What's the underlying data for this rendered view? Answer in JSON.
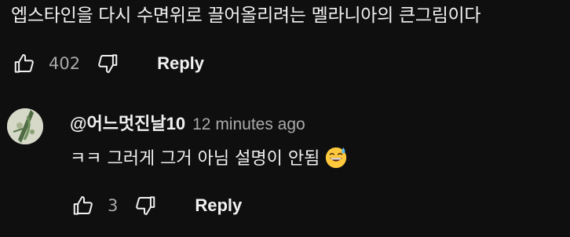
{
  "parent_comment": {
    "text_tail": "엡스타인을 다시 수면위로 끌어올리려는 멜라니아의 큰그림이다",
    "like_count": "402",
    "reply_label": "Reply"
  },
  "reply_comment": {
    "author": "@어느멋진날10",
    "timestamp": "12 minutes ago",
    "text": "ㅋㅋ 그러게 그거 아님 설명이 안됨",
    "emoji": "grinning-face-with-sweat",
    "like_count": "3",
    "reply_label": "Reply"
  },
  "colors": {
    "background": "#0f0f0f",
    "text_primary": "#f1f1f1",
    "text_secondary": "#aaaaaa"
  }
}
